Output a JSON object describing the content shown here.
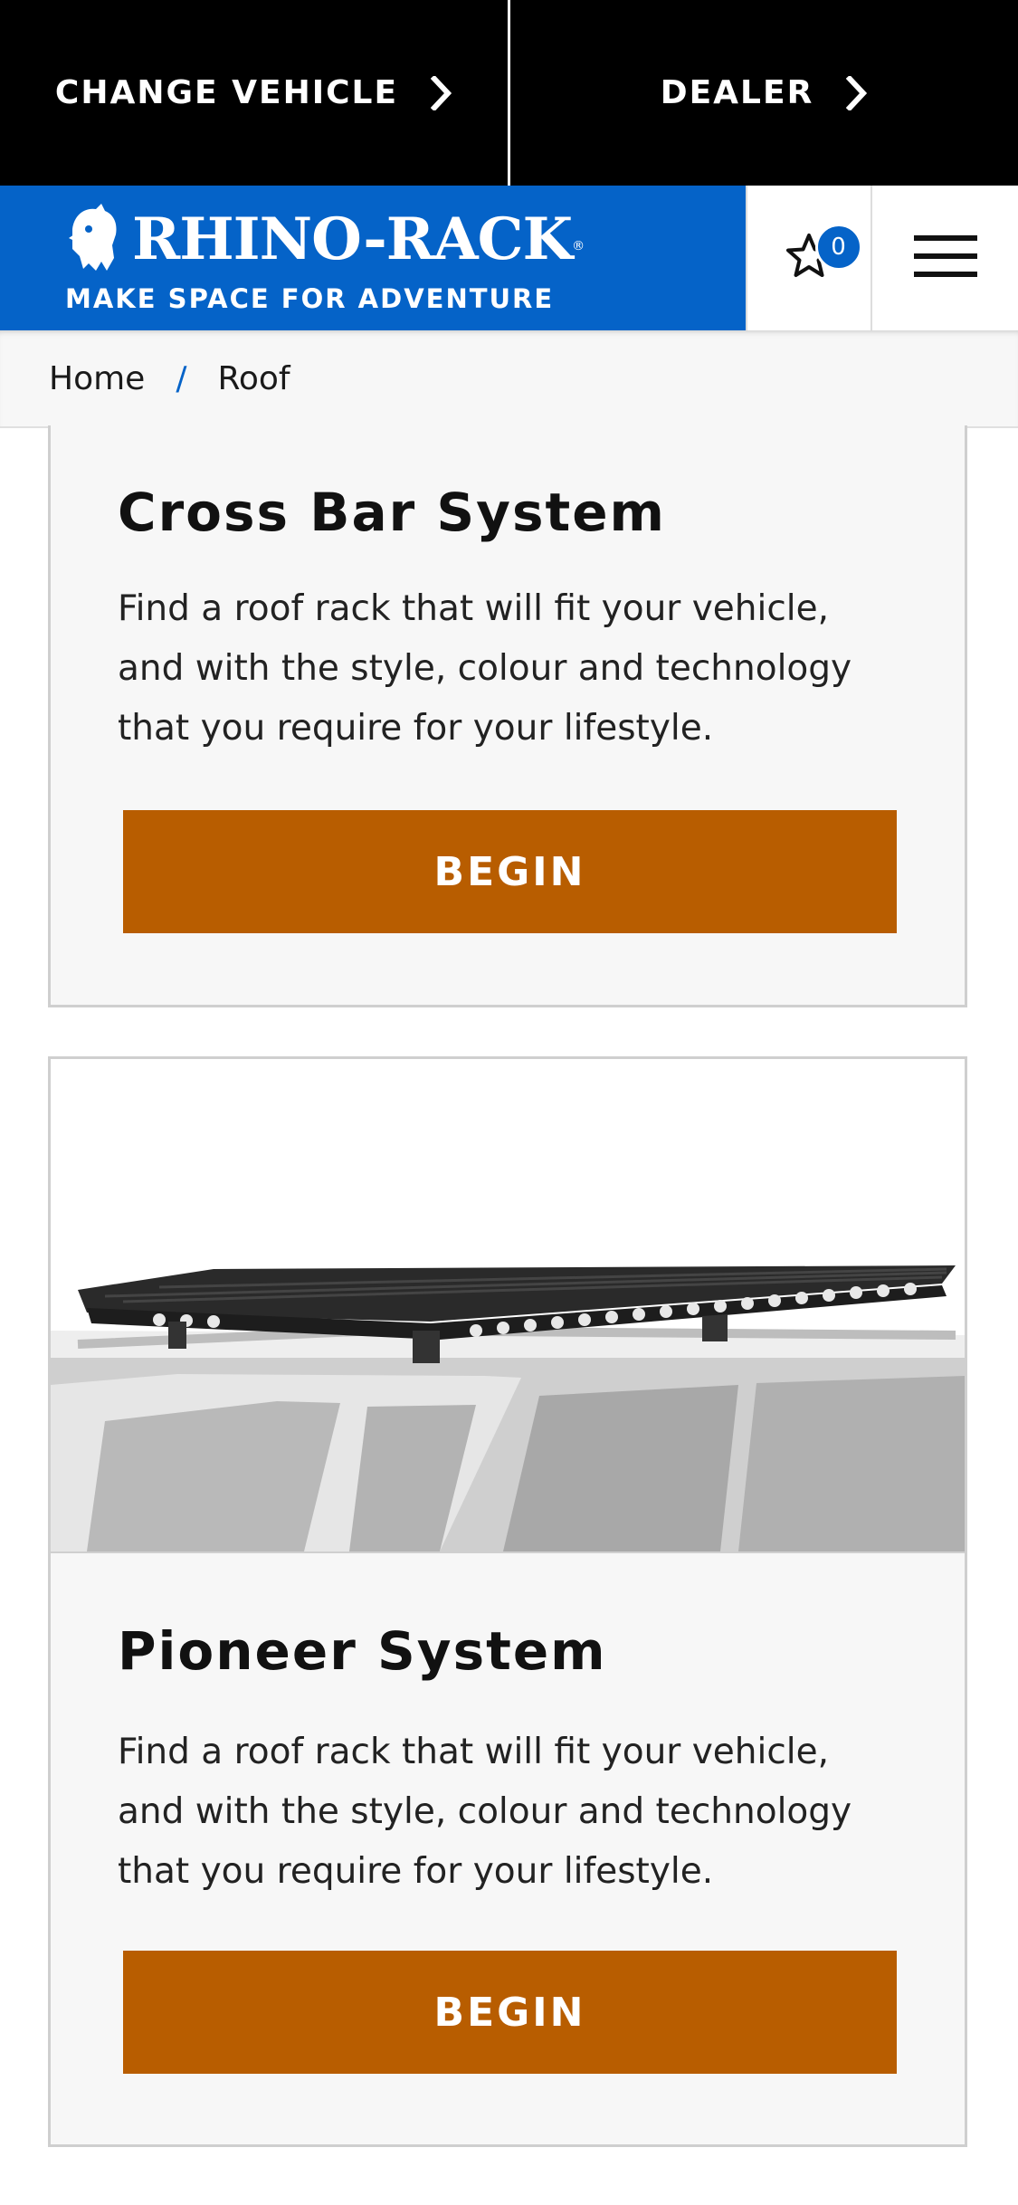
{
  "topbar": {
    "change_vehicle": "CHANGE VEHICLE",
    "dealer": "DEALER"
  },
  "brand": {
    "name": "RHINO-RACK",
    "reg": "®",
    "tagline": "MAKE SPACE FOR ADVENTURE",
    "color": "#0563c8"
  },
  "wishlist": {
    "count": "0"
  },
  "breadcrumb": {
    "home": "Home",
    "separator": "/",
    "current": "Roof"
  },
  "cards": [
    {
      "title": "Cross Bar System",
      "description": "Find a roof rack that will fit your vehicle, and with the style, colour and technology that you require for your lifestyle.",
      "button": "BEGIN"
    },
    {
      "title": "Pioneer System",
      "description": "Find a roof rack that will fit your vehicle, and with the style, colour and technology that you require for your lifestyle.",
      "button": "BEGIN",
      "image": "pioneer-platform-on-vehicle-roof"
    }
  ],
  "colors": {
    "accent_button": "#b85d00",
    "brand_blue": "#0563c8"
  }
}
